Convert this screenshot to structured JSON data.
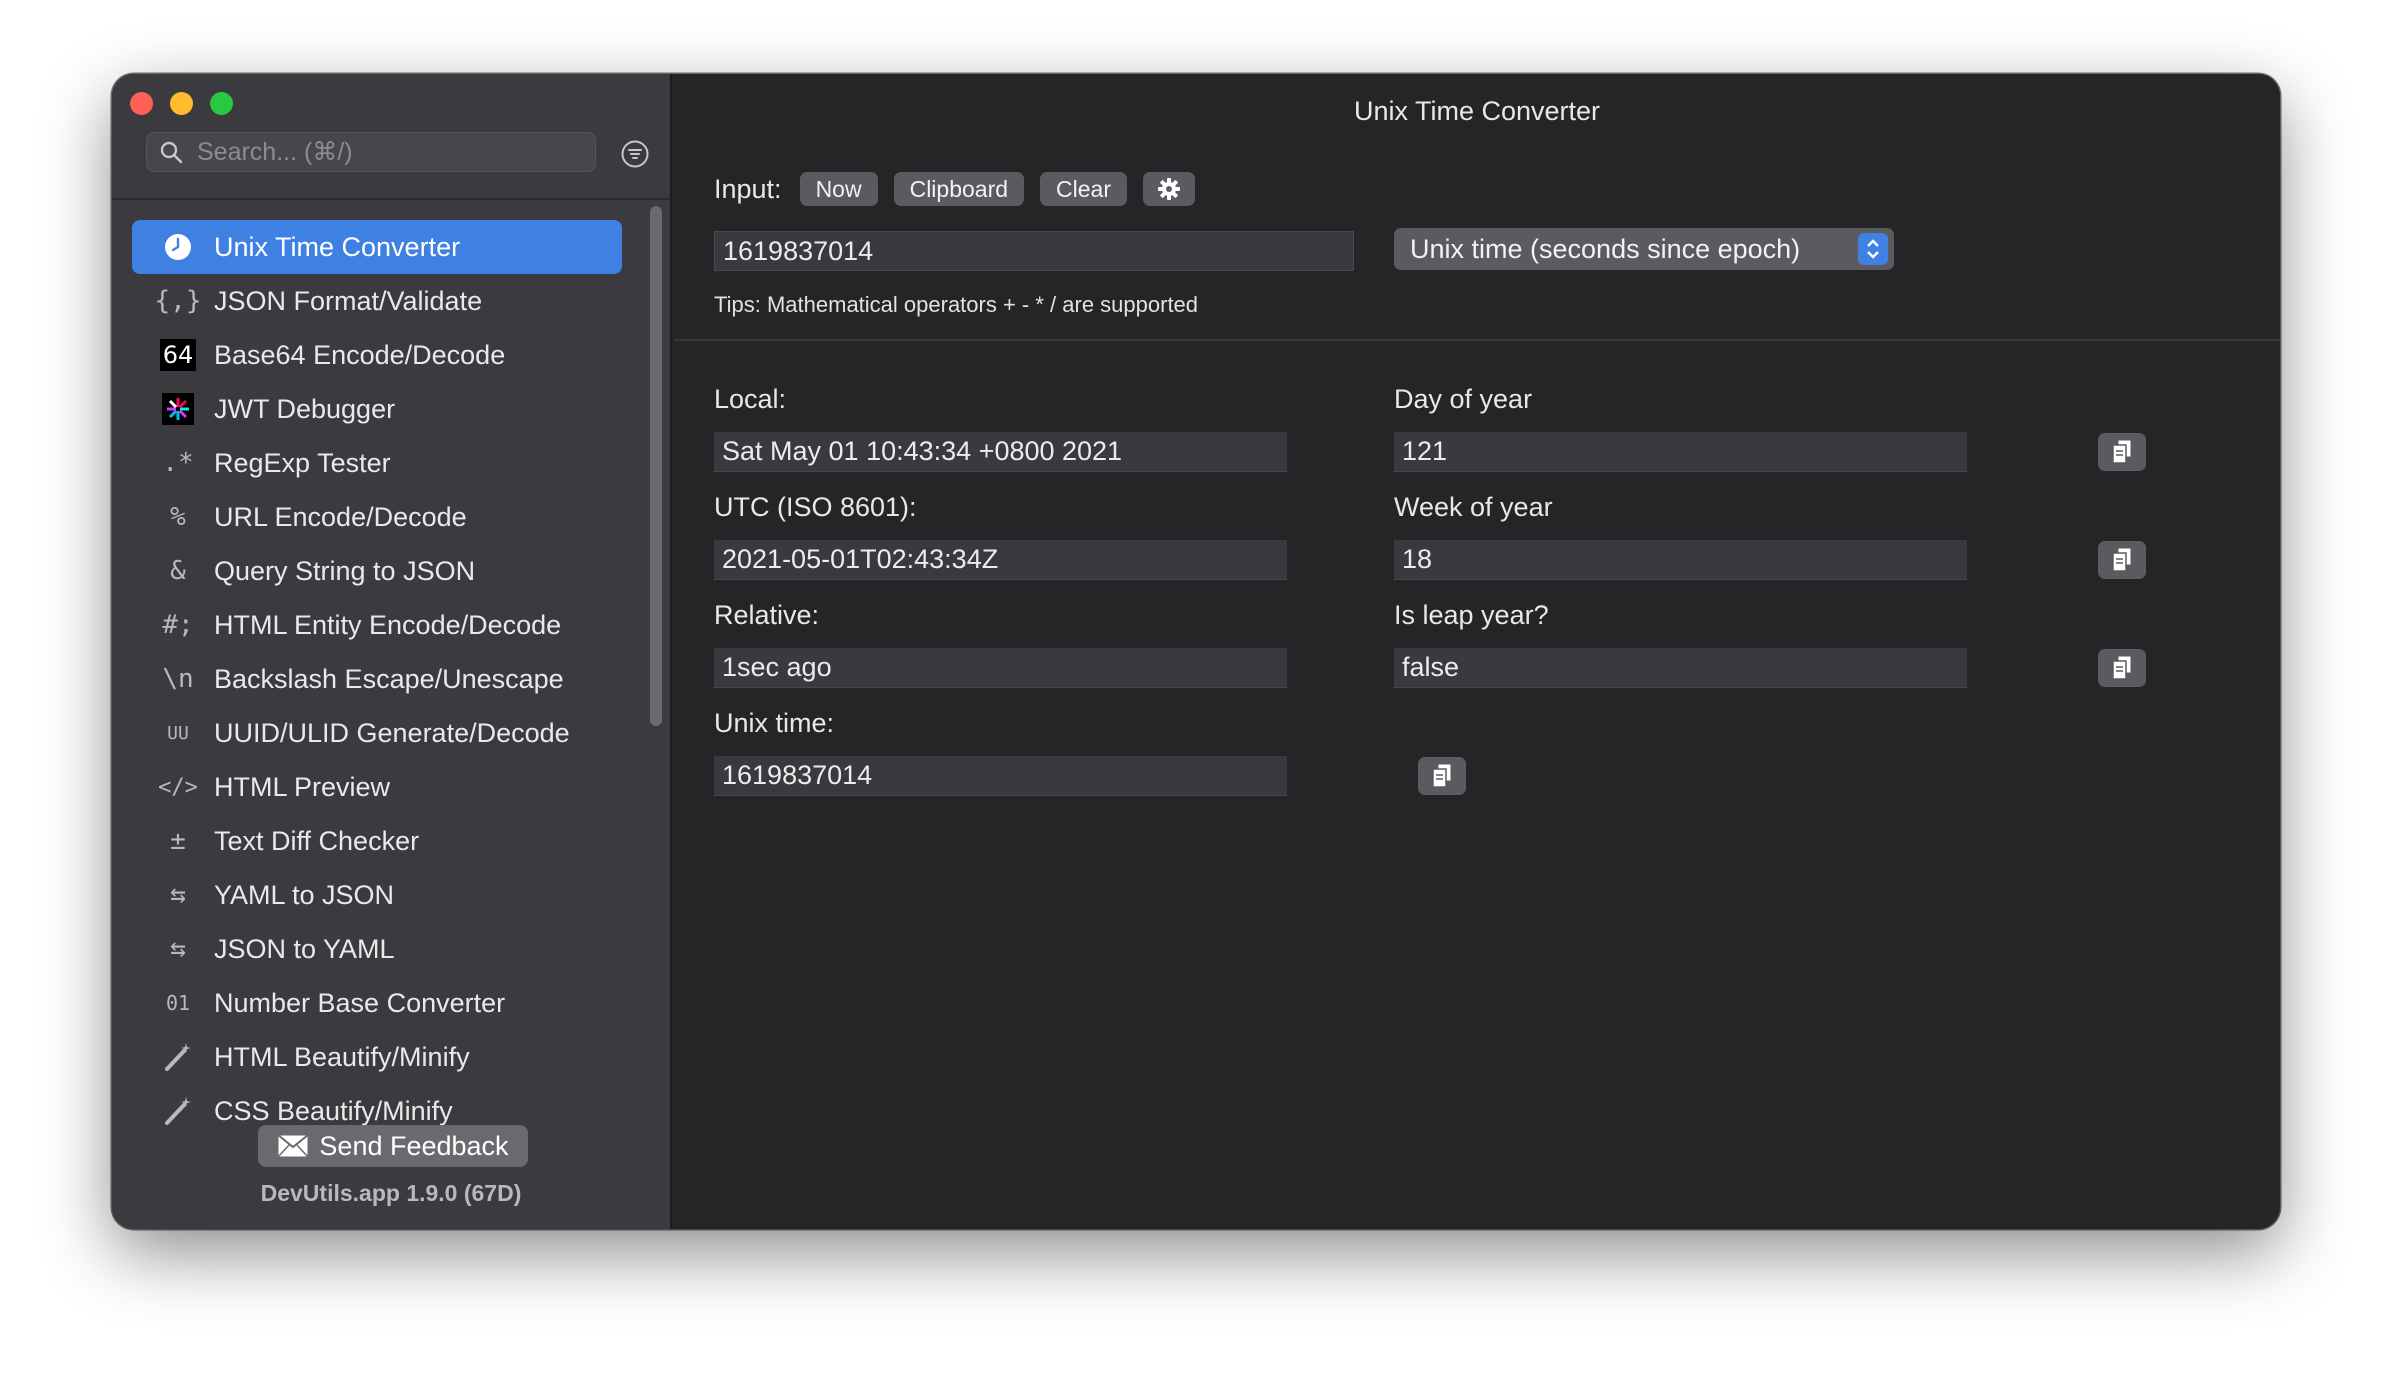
{
  "sidebar": {
    "search_placeholder": "Search... (⌘/)",
    "items": [
      {
        "label": "Unix Time Converter",
        "icon": "clock-icon",
        "glyph": ""
      },
      {
        "label": "JSON Format/Validate",
        "icon": "braces-icon",
        "glyph": "{,}"
      },
      {
        "label": "Base64 Encode/Decode",
        "icon": "base64-icon",
        "glyph": "64"
      },
      {
        "label": "JWT Debugger",
        "icon": "jwt-icon",
        "glyph": ""
      },
      {
        "label": "RegExp Tester",
        "icon": "regex-icon",
        "glyph": ".*"
      },
      {
        "label": "URL Encode/Decode",
        "icon": "percent-icon",
        "glyph": "%"
      },
      {
        "label": "Query String to JSON",
        "icon": "ampersand-icon",
        "glyph": "&"
      },
      {
        "label": "HTML Entity Encode/Decode",
        "icon": "hash-icon",
        "glyph": "#;"
      },
      {
        "label": "Backslash Escape/Unescape",
        "icon": "backslash-icon",
        "glyph": "\\n"
      },
      {
        "label": "UUID/ULID Generate/Decode",
        "icon": "uuid-icon",
        "glyph": "UU"
      },
      {
        "label": "HTML Preview",
        "icon": "code-tag-icon",
        "glyph": "</>"
      },
      {
        "label": "Text Diff Checker",
        "icon": "diff-icon",
        "glyph": "±"
      },
      {
        "label": "YAML to JSON",
        "icon": "swap-icon",
        "glyph": "⇆"
      },
      {
        "label": "JSON to YAML",
        "icon": "swap-icon",
        "glyph": "⇆"
      },
      {
        "label": "Number Base Converter",
        "icon": "binary-icon",
        "glyph": "01"
      },
      {
        "label": "HTML Beautify/Minify",
        "icon": "magic-wand-icon",
        "glyph": "⁄"
      },
      {
        "label": "CSS Beautify/Minify",
        "icon": "magic-wand-icon",
        "glyph": "⁄"
      }
    ],
    "feedback_label": "Send Feedback",
    "version": "DevUtils.app 1.9.0 (67D)"
  },
  "main": {
    "title": "Unix Time Converter",
    "input_label": "Input:",
    "buttons": {
      "now": "Now",
      "clipboard": "Clipboard",
      "clear": "Clear"
    },
    "input_value": "1619837014",
    "format_selected": "Unix time (seconds since epoch)",
    "tips": "Tips: Mathematical operators + - * / are supported",
    "fields": {
      "local": {
        "label": "Local:",
        "value": "Sat May 01 10:43:34 +0800 2021"
      },
      "utc": {
        "label": "UTC (ISO 8601):",
        "value": "2021-05-01T02:43:34Z"
      },
      "relative": {
        "label": "Relative:",
        "value": "1sec ago"
      },
      "unix": {
        "label": "Unix time:",
        "value": "1619837014"
      },
      "day_of_year": {
        "label": "Day of year",
        "value": "121"
      },
      "week_of_year": {
        "label": "Week of year",
        "value": "18"
      },
      "leap_year": {
        "label": "Is leap year?",
        "value": "false"
      }
    }
  },
  "colors": {
    "accent": "#3f81e3",
    "sidebar_bg": "#3b3a3f",
    "main_bg": "#252427"
  }
}
